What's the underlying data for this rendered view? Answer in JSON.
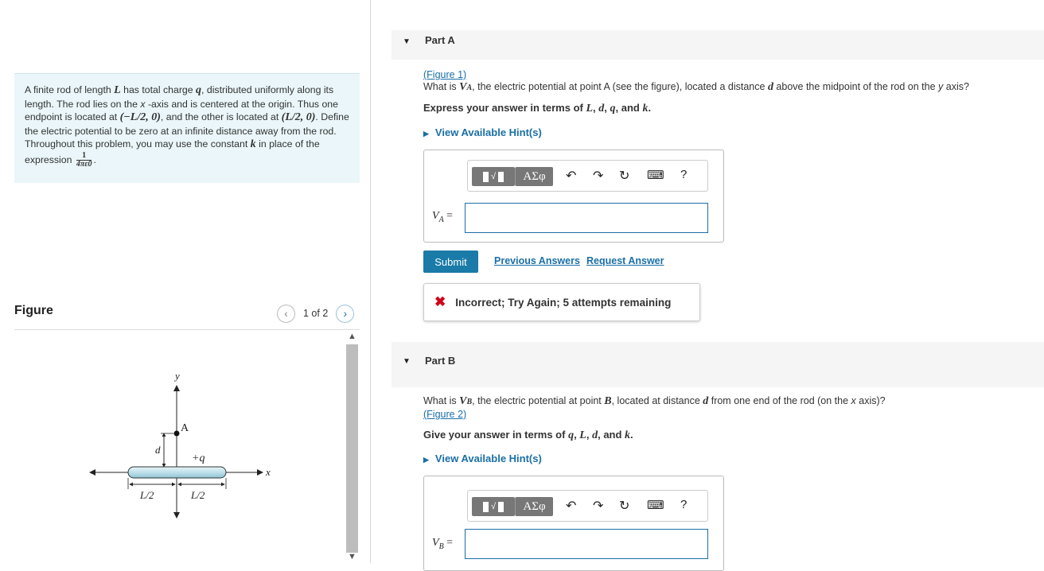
{
  "problem": {
    "p1": "A finite rod of length ",
    "L": "L",
    "p2": " has total charge ",
    "q": "q",
    "p3": ", distributed uniformly along its length. The rod lies on the ",
    "x": "x",
    "p4": " -axis and is centered at the origin. Thus one endpoint is located at ",
    "pt1": "(−L/2, 0)",
    "p5": ", and the other is located at ",
    "pt2": "(L/2, 0)",
    "p6": ". Define the electric potential to be zero at an infinite distance away from the rod. Throughout this problem, you may use the constant ",
    "k": "k",
    "p7": " in place of the expression ",
    "frac_num": "1",
    "frac_den": "4πε0",
    "p8": "."
  },
  "figure": {
    "title": "Figure",
    "page": "1 of 2",
    "prev_icon": "chevron-left-icon",
    "next_icon": "chevron-right-icon",
    "labels": {
      "y": "y",
      "x": "x",
      "A": "A",
      "d": "d",
      "charge": "+q",
      "half_left": "L/2",
      "half_right": "L/2"
    }
  },
  "partA": {
    "header": "Part A",
    "figure_link": "(Figure 1)",
    "q1": "What is ",
    "var": "V",
    "sub": "A",
    "q2": ", the electric potential at point A (see the figure), located a distance ",
    "d": "d",
    "q3": " above the midpoint of the rod on the ",
    "y": "y",
    "q4": " axis?",
    "express_pre": "Express your answer in terms of ",
    "terms": [
      "L",
      "d",
      "q",
      "k"
    ],
    "hint": "View Available Hint(s)",
    "answer_label_var": "V",
    "answer_label_sub": "A",
    "answer_value": "",
    "submit": "Submit",
    "previous_answers": "Previous Answers",
    "request_answer": "Request Answer",
    "feedback": "Incorrect; Try Again; 5 attempts remaining"
  },
  "partB": {
    "header": "Part B",
    "q1": "What is ",
    "var": "V",
    "sub": "B",
    "q2": ", the electric potential at point ",
    "B": "B",
    "q3": ", located at distance ",
    "d": "d",
    "q4": " from one end of the rod (on the ",
    "x": "x",
    "q5": " axis)?",
    "figure_link": "(Figure 2)",
    "express_pre": "Give your answer in terms of ",
    "terms": [
      "q",
      "L",
      "d",
      "k"
    ],
    "hint": "View Available Hint(s)",
    "answer_label_var": "V",
    "answer_label_sub": "B",
    "answer_value": ""
  },
  "toolbar": {
    "greek": "ΑΣφ",
    "help": "?",
    "icons": [
      "templates-icon",
      "greek-symbols-icon",
      "undo-icon",
      "redo-icon",
      "reset-icon",
      "keyboard-icon",
      "help-icon"
    ]
  },
  "colors": {
    "link": "#1a6fa6",
    "submit_bg": "#1a7ba8",
    "problem_bg": "#eaf6f9",
    "error": "#d0021b"
  }
}
